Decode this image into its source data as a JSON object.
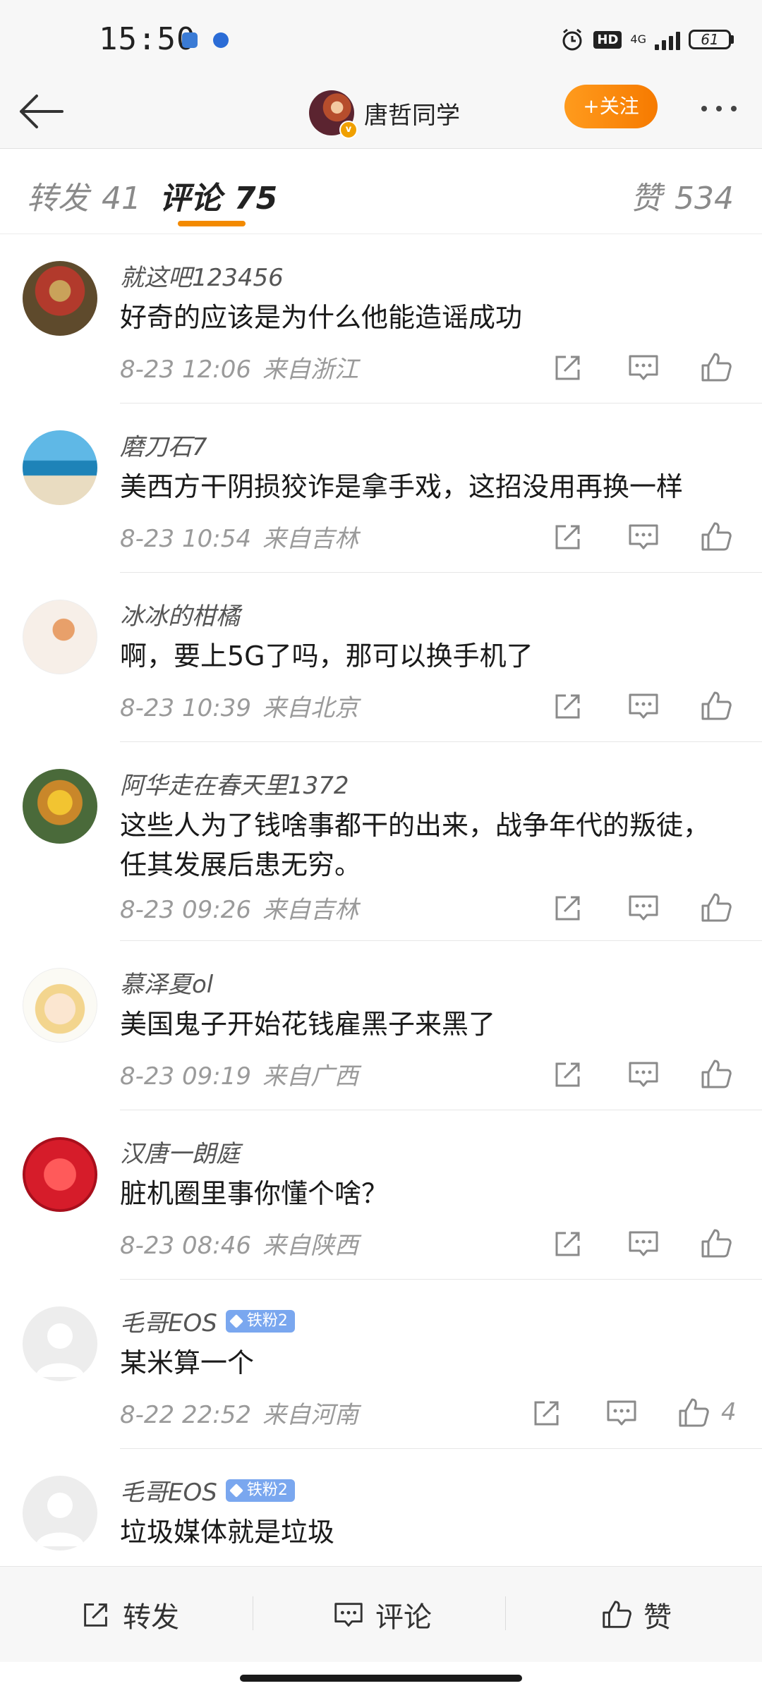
{
  "status_bar": {
    "time": "15:50",
    "network": "4G",
    "battery": "61"
  },
  "header": {
    "username": "唐哲同学",
    "follow_label": "+关注"
  },
  "tabs": [
    {
      "label": "转发",
      "count": "41"
    },
    {
      "label": "评论",
      "count": "75"
    },
    {
      "label": "赞",
      "count": "534"
    }
  ],
  "comments": [
    {
      "user": "就这吧123456",
      "text": "好奇的应该是为什么他能造谣成功",
      "date": "8-23 12:06",
      "location": "来自浙江",
      "likes": ""
    },
    {
      "user": "磨刀石7",
      "text": "美西方干阴损狡诈是拿手戏，这招没用再换一样",
      "date": "8-23 10:54",
      "location": "来自吉林",
      "likes": ""
    },
    {
      "user": "冰冰的柑橘",
      "text": "啊，要上5G了吗，那可以换手机了",
      "date": "8-23 10:39",
      "location": "来自北京",
      "likes": ""
    },
    {
      "user": "阿华走在春天里1372",
      "text": "这些人为了钱啥事都干的出来，战争年代的叛徒，任其发展后患无穷。",
      "date": "8-23 09:26",
      "location": "来自吉林",
      "likes": ""
    },
    {
      "user": "慕泽夏ol",
      "text": "美国鬼子开始花钱雇黑子来黑了",
      "date": "8-23 09:19",
      "location": "来自广西",
      "likes": ""
    },
    {
      "user": "汉唐一朗庭",
      "text": "脏机圈里事你懂个啥？",
      "date": "8-23 08:46",
      "location": "来自陕西",
      "likes": ""
    },
    {
      "user": "毛哥EOS",
      "badge": "铁粉2",
      "text": "某米算一个",
      "date": "8-22 22:52",
      "location": "来自河南",
      "likes": "4"
    },
    {
      "user": "毛哥EOS",
      "badge": "铁粉2",
      "text": "垃圾媒体就是垃圾",
      "date": "",
      "location": "",
      "likes": ""
    }
  ],
  "bottom_bar": {
    "repost": "转发",
    "comment": "评论",
    "like": "赞"
  },
  "colors": {
    "accent": "#f38a00",
    "follow_button": "#ff9b1d",
    "fan_badge": "#7aa7ef"
  }
}
